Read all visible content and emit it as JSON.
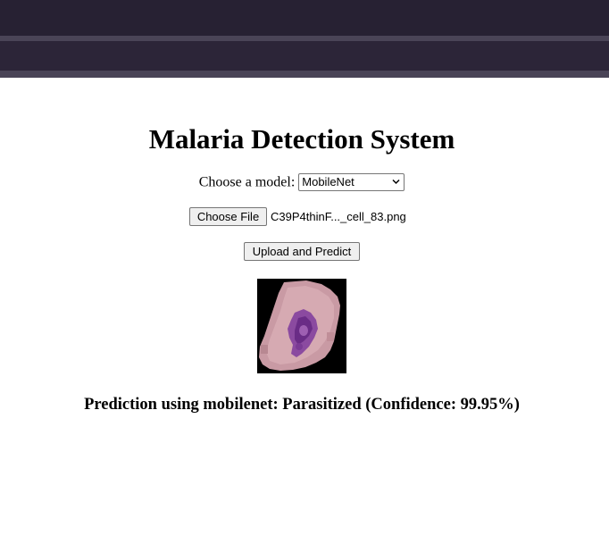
{
  "header": {
    "title": "Malaria Detection System"
  },
  "model_select": {
    "label": "Choose a model:",
    "selected": "MobileNet"
  },
  "file_input": {
    "button_label": "Choose File",
    "file_name": "C39P4thinF..._cell_83.png"
  },
  "upload_button": {
    "label": "Upload and Predict"
  },
  "result": {
    "text": "Prediction using mobilenet: Parasitized (Confidence: 99.95%)"
  },
  "colors": {
    "topbar": "#272133",
    "topbar_accent": "#4a4457",
    "button_bg": "#efefef"
  },
  "icons": {
    "select_arrow": "chevron-down-icon"
  }
}
